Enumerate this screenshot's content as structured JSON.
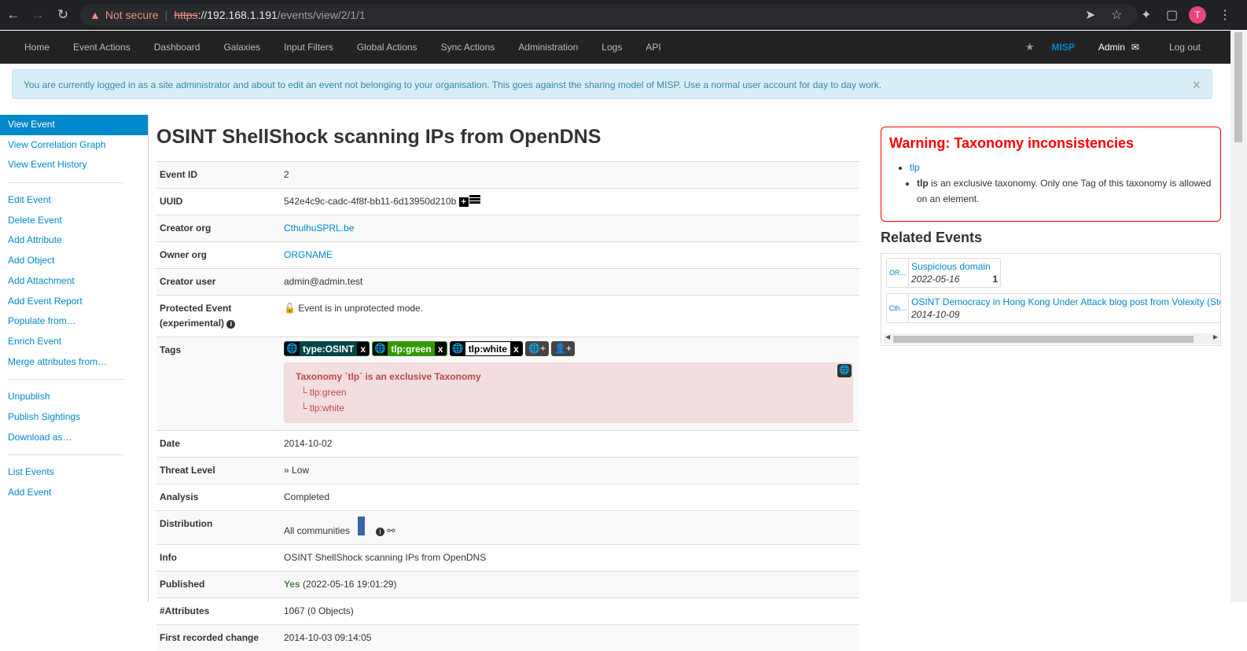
{
  "browser": {
    "not_secure": "Not secure",
    "url_protocol": "https",
    "url_host": "://192.168.1.191",
    "url_path": "/events/view/2/1/1",
    "avatar_letter": "T"
  },
  "navbar": {
    "items": [
      "Home",
      "Event Actions",
      "Dashboard",
      "Galaxies",
      "Input Filters",
      "Global Actions",
      "Sync Actions",
      "Administration",
      "Logs",
      "API"
    ],
    "brand": "MISP",
    "user": "Admin",
    "logout": "Log out"
  },
  "alert": {
    "text": "You are currently logged in as a site administrator and about to edit an event not belonging to your organisation. This goes against the sharing model of MISP. Use a normal user account for day to day work.",
    "close": "×"
  },
  "sidebar": {
    "items": [
      "View Event",
      "View Correlation Graph",
      "View Event History",
      "Edit Event",
      "Delete Event",
      "Add Attribute",
      "Add Object",
      "Add Attachment",
      "Add Event Report",
      "Populate from…",
      "Enrich Event",
      "Merge attributes from…",
      "Unpublish",
      "Publish Sightings",
      "Download as…",
      "List Events",
      "Add Event"
    ]
  },
  "event": {
    "title": "OSINT ShellShock scanning IPs from OpenDNS",
    "labels": {
      "event_id": "Event ID",
      "uuid": "UUID",
      "creator_org": "Creator org",
      "owner_org": "Owner org",
      "creator_user": "Creator user",
      "protected": "Protected Event (experimental)",
      "tags": "Tags",
      "date": "Date",
      "threat_level": "Threat Level",
      "analysis": "Analysis",
      "distribution": "Distribution",
      "info": "Info",
      "published": "Published",
      "attributes": "#Attributes",
      "first_change": "First recorded change"
    },
    "event_id": "2",
    "uuid": "542e4c9c-cadc-4f8f-bb11-6d13950d210b",
    "creator_org": "CthulhuSPRL.be",
    "owner_org": "ORGNAME",
    "creator_user": "admin@admin.test",
    "protected": "Event is in unprotected mode.",
    "tags": [
      {
        "label": "type:OSINT",
        "bg": "#004646",
        "fg": "#ffffff"
      },
      {
        "label": "tlp:green",
        "bg": "#339900",
        "fg": "#ffffff"
      },
      {
        "label": "tlp:white",
        "bg": "#ffffff",
        "fg": "#000000"
      }
    ],
    "taxonomy_warning": {
      "title": "Taxonomy `tlp` is an exclusive Taxonomy",
      "items": [
        "tlp:green",
        "tlp:white"
      ]
    },
    "date": "2014-10-02",
    "threat_level": "Low",
    "analysis": "Completed",
    "distribution": "All communities",
    "info": "OSINT ShellShock scanning IPs from OpenDNS",
    "published_yes": "Yes",
    "published_date": "(2022-05-16 19:01:29)",
    "attributes": "1067 (0 Objects)",
    "first_change": "2014-10-03 09:14:05"
  },
  "warning_box": {
    "title": "Warning: Taxonomy inconsistencies",
    "taxonomy": "tlp",
    "bold": "tlp",
    "text": " is an exclusive taxonomy. Only one Tag of this taxonomy is allowed on an element."
  },
  "related": {
    "title": "Related Events",
    "items": [
      {
        "org": "OR...",
        "title": "Suspicious domain",
        "date": "2022-05-16",
        "count": "1"
      },
      {
        "org": "Cth...",
        "title": "OSINT Democracy in Hong Kong Under Attack blog post from Volexity (Ste",
        "date": "2014-10-09",
        "count": ""
      }
    ]
  }
}
